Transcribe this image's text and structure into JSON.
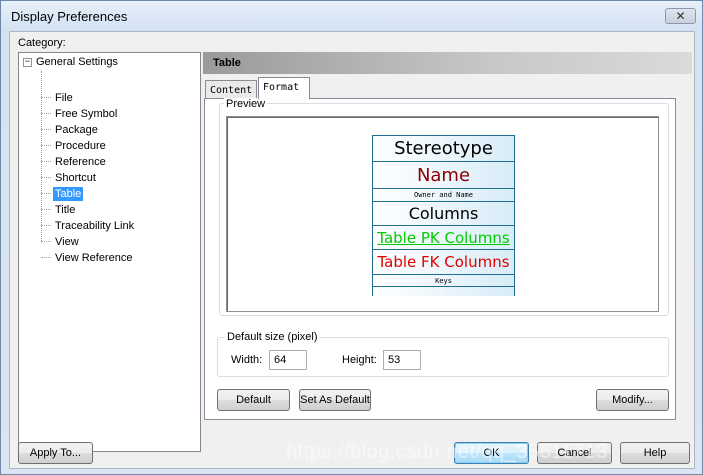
{
  "window": {
    "title": "Display Preferences",
    "close_glyph": "✕"
  },
  "category": {
    "label": "Category:",
    "root": "General Settings",
    "expander": "−",
    "items": [
      "File",
      "Free Symbol",
      "Package",
      "Procedure",
      "Reference",
      "Shortcut",
      "Table",
      "Title",
      "Traceability Link",
      "View",
      "View Reference"
    ],
    "selected": "Table"
  },
  "panel": {
    "title": "Table",
    "tabs": [
      "Content",
      "Format"
    ],
    "active_tab": "Format"
  },
  "preview": {
    "label": "Preview",
    "table": {
      "stereotype": "Stereotype",
      "name": "Name",
      "owner": "Owner and Name",
      "columns": "Columns",
      "pk_columns": "Table PK Columns",
      "fk_columns": "Table FK Columns",
      "keys": "Keys"
    },
    "colors": {
      "border": "#1e6f93",
      "name": "#8b0000",
      "pk": "#00cc00",
      "fk": "#e00000"
    }
  },
  "default_size": {
    "label": "Default size (pixel)",
    "width_label": "Width:",
    "width_value": "64",
    "height_label": "Height:",
    "height_value": "53"
  },
  "buttons": {
    "default": "Default",
    "set_as_default": "Set As Default",
    "modify": "Modify...",
    "apply_to": "Apply To...",
    "ok": "OK",
    "cancel": "Cancel",
    "help": "Help"
  },
  "watermark": "https://blog.csdn.net/qq_35611713"
}
